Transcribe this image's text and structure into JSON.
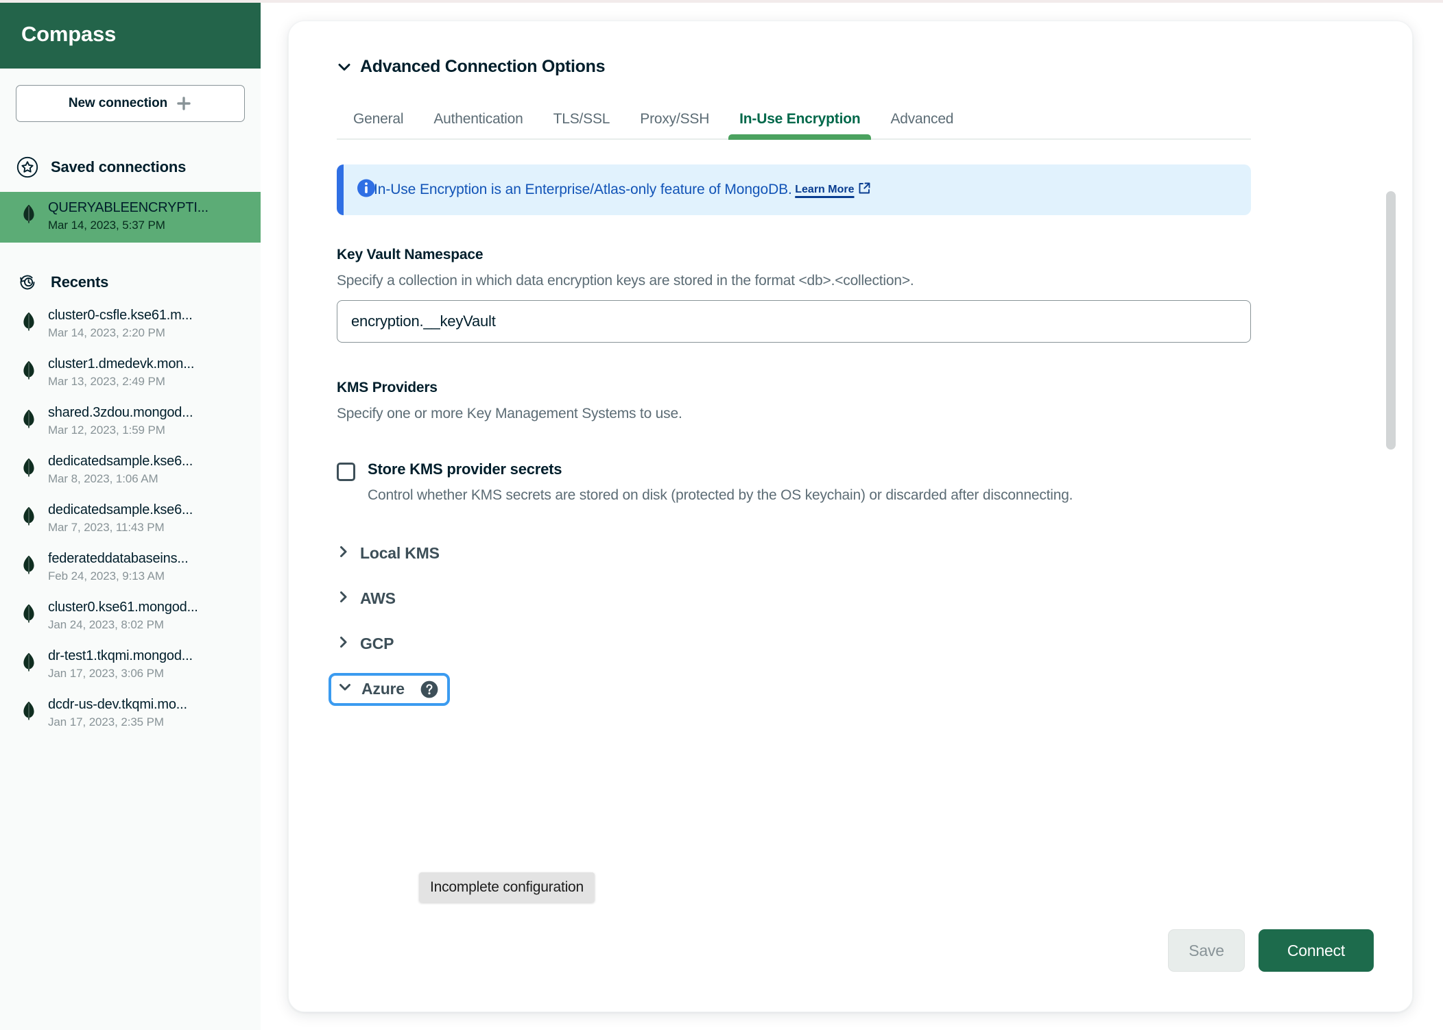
{
  "app": {
    "title": "Compass",
    "brand_color": "#23644a",
    "accent_green": "#00684a"
  },
  "sidebar": {
    "new_connection_label": "New connection",
    "saved_connections_label": "Saved connections",
    "recents_label": "Recents",
    "saved_connections": [
      {
        "name": "QUERYABLEENCRYPTI...",
        "date": "Mar 14, 2023, 5:37 PM",
        "selected": true
      }
    ],
    "recents": [
      {
        "name": "cluster0-csfle.kse61.m...",
        "date": "Mar 14, 2023, 2:20 PM"
      },
      {
        "name": "cluster1.dmedevk.mon...",
        "date": "Mar 13, 2023, 2:49 PM"
      },
      {
        "name": "shared.3zdou.mongod...",
        "date": "Mar 12, 2023, 1:59 PM"
      },
      {
        "name": "dedicatedsample.kse6...",
        "date": "Mar 8, 2023, 1:06 AM"
      },
      {
        "name": "dedicatedsample.kse6...",
        "date": "Mar 7, 2023, 11:43 PM"
      },
      {
        "name": "federateddatabaseins...",
        "date": "Feb 24, 2023, 9:13 AM"
      },
      {
        "name": "cluster0.kse61.mongod...",
        "date": "Jan 24, 2023, 8:02 PM"
      },
      {
        "name": "dr-test1.tkqmi.mongod...",
        "date": "Jan 17, 2023, 3:06 PM"
      },
      {
        "name": "dcdr-us-dev.tkqmi.mo...",
        "date": "Jan 17, 2023, 2:35 PM"
      }
    ]
  },
  "main": {
    "advanced_options_title": "Advanced Connection Options",
    "tabs": [
      {
        "label": "General",
        "active": false
      },
      {
        "label": "Authentication",
        "active": false
      },
      {
        "label": "TLS/SSL",
        "active": false
      },
      {
        "label": "Proxy/SSH",
        "active": false
      },
      {
        "label": "In-Use Encryption",
        "active": true
      },
      {
        "label": "Advanced",
        "active": false
      }
    ],
    "banner": {
      "text": "In-Use Encryption is an Enterprise/Atlas-only feature of MongoDB.",
      "link_label": "Learn More",
      "accent_color": "#2f6fe4",
      "background": "#e1f2fd"
    },
    "key_vault": {
      "label": "Key Vault Namespace",
      "description": "Specify a collection in which data encryption keys are stored in the format <db>.<collection>.",
      "value": "encryption.__keyVault",
      "placeholder": "db.collection"
    },
    "kms_providers": {
      "label": "KMS Providers",
      "description": "Specify one or more Key Management Systems to use.",
      "store_secrets": {
        "title": "Store KMS provider secrets",
        "description": "Control whether KMS secrets are stored on disk (protected by the OS keychain) or discarded after disconnecting.",
        "checked": false
      },
      "sections": [
        {
          "label": "Local KMS",
          "expanded": false,
          "has_warning": false,
          "focused": false
        },
        {
          "label": "AWS",
          "expanded": false,
          "has_warning": false,
          "focused": false
        },
        {
          "label": "GCP",
          "expanded": false,
          "has_warning": false,
          "focused": false
        },
        {
          "label": "Azure",
          "expanded": true,
          "has_warning": true,
          "focused": true
        }
      ]
    },
    "tooltip": "Incomplete configuration",
    "footer": {
      "save_label": "Save",
      "connect_label": "Connect"
    }
  }
}
